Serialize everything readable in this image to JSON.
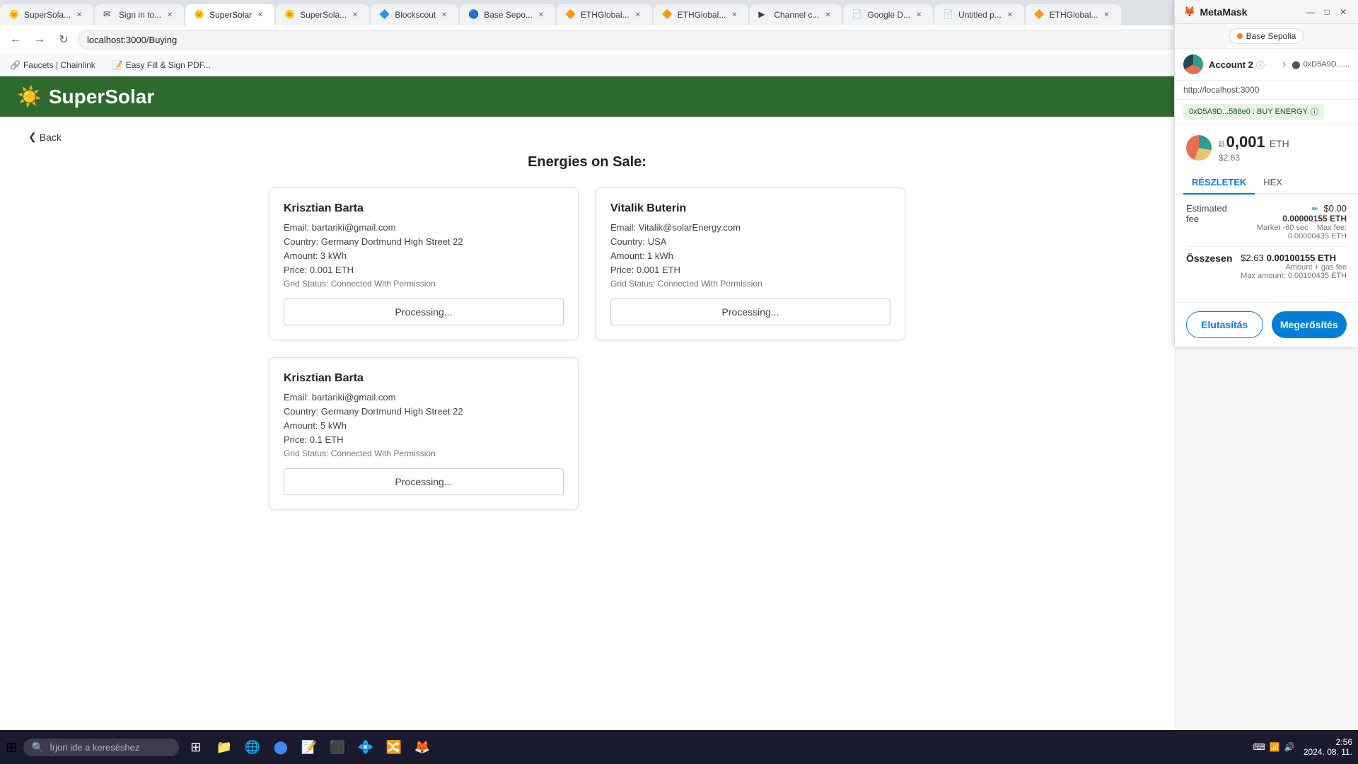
{
  "browser": {
    "tabs": [
      {
        "label": "SuperSola...",
        "favicon": "🌞",
        "active": false,
        "closable": true
      },
      {
        "label": "Sign in to...",
        "favicon": "✉",
        "active": false,
        "closable": true
      },
      {
        "label": "SuperSolar",
        "favicon": "🌞",
        "active": true,
        "closable": true
      },
      {
        "label": "SuperSola...",
        "favicon": "🌞",
        "active": false,
        "closable": true
      },
      {
        "label": "Blockscout",
        "favicon": "🔷",
        "active": false,
        "closable": true
      },
      {
        "label": "Base Sepo...",
        "favicon": "🔵",
        "active": false,
        "closable": true
      },
      {
        "label": "ETHGlobal...",
        "favicon": "🔶",
        "active": false,
        "closable": true
      },
      {
        "label": "ETHGlobal...",
        "favicon": "🔶",
        "active": false,
        "closable": true
      },
      {
        "label": "Channel c...",
        "favicon": "▶",
        "active": false,
        "closable": true
      },
      {
        "label": "Google D...",
        "favicon": "📄",
        "active": false,
        "closable": true
      },
      {
        "label": "Untitled p...",
        "favicon": "📄",
        "active": false,
        "closable": true
      },
      {
        "label": "ETHGlobal...",
        "favicon": "🔶",
        "active": false,
        "closable": true
      }
    ],
    "address": "localhost:3000/Buying",
    "bookmarks": [
      {
        "label": "Faucets | Chainlink",
        "favicon": "🔗"
      },
      {
        "label": "Easy Fill & Sign PDF...",
        "favicon": "📝"
      }
    ]
  },
  "supersolar": {
    "logo_text": "SuperSolar",
    "back_label": "Back",
    "page_title": "Energies on Sale:",
    "cards": [
      {
        "name": "Krisztian Barta",
        "email": "Email: bartariki@gmail.com",
        "country": "Country: Germany Dortmund High Street 22",
        "amount": "Amount: 3 kWh",
        "price": "Price: 0.001 ETH",
        "grid_status": "Grid Status: Connected With Permission",
        "button_label": "Processing..."
      },
      {
        "name": "Vitalik Buterin",
        "email": "Email: Vitalik@solarEnergy.com",
        "country": "Country: USA",
        "amount": "Amount: 1 kWh",
        "price": "Price: 0.001 ETH",
        "grid_status": "Grid Status: Connected With Permission",
        "button_label": "Processing..."
      },
      {
        "name": "Krisztian Barta",
        "email": "Email: bartariki@gmail.com",
        "country": "Country: Germany Dortmund High Street 22",
        "amount": "Amount: 5 kWh",
        "price": "Price: 0.1 ETH",
        "grid_status": "Grid Status: Connected With Permission",
        "button_label": "Processing..."
      }
    ]
  },
  "metamask": {
    "title": "MetaMask",
    "network": "Base Sepolia",
    "account_name": "Account 2",
    "account_address": "0xD5A9D......",
    "url": "http://localhost:3000",
    "contract_label": "0xD5A9D...588e0 : BUY ENERGY",
    "eth_amount": "0,001",
    "eth_symbol": "ETH",
    "usd_value": "$2.63",
    "tab_details": "RÉSZLETEK",
    "tab_hex": "HEX",
    "estimated_fee_label": "Estimated fee",
    "estimated_fee_usd": "$0.00",
    "estimated_fee_eth": "0.00000155 ETH",
    "market_note": "Market -60 sec",
    "max_fee_label": "Max fee:",
    "max_fee_eth": "0.00000435 ETH",
    "total_label": "Összesen",
    "total_usd": "$2.63",
    "total_eth": "0.00100155 ETH",
    "amount_gas_label": "Amount + gas fee",
    "max_amount_label": "Max amount:",
    "max_amount_eth": "0.00100435 ETH",
    "btn_reject": "Elutasítás",
    "btn_confirm": "Megerősítés"
  },
  "taskbar": {
    "search_placeholder": "Írjon ide a kereséshez",
    "time": "2:56",
    "date": "2024. 08. 11."
  }
}
